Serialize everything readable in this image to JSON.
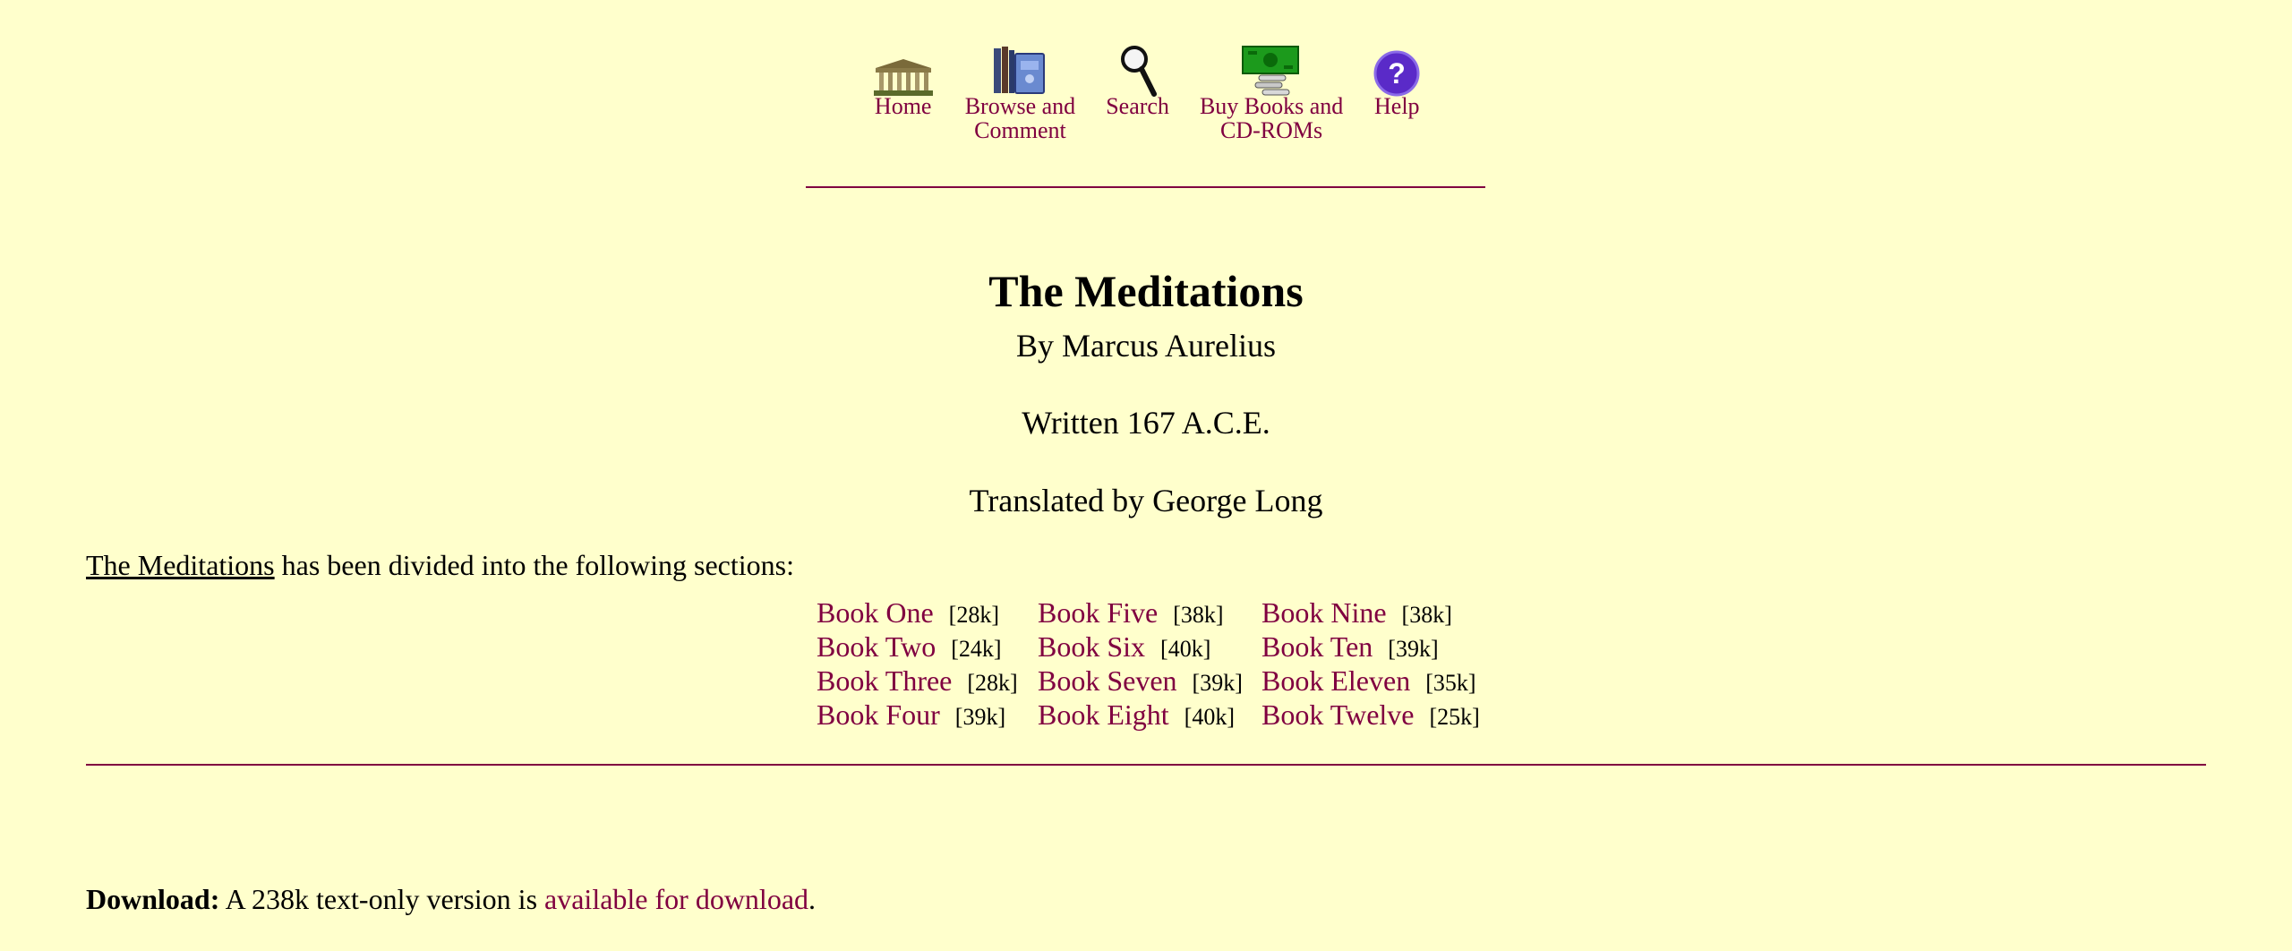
{
  "nav": [
    {
      "icon": "home-temple-icon",
      "label_lines": [
        "Home"
      ]
    },
    {
      "icon": "browse-books-icon",
      "label_lines": [
        "Browse and",
        "Comment"
      ]
    },
    {
      "icon": "search-magnifier-icon",
      "label_lines": [
        "Search"
      ]
    },
    {
      "icon": "buy-books-money-icon",
      "label_lines": [
        "Buy Books and",
        "CD-ROMs"
      ]
    },
    {
      "icon": "help-question-icon",
      "label_lines": [
        "Help"
      ]
    }
  ],
  "page": {
    "title": "The Meditations",
    "author": "By Marcus Aurelius",
    "written": "Written 167 A.C.E.",
    "translator": "Translated by George Long",
    "intro_title": "The Meditations",
    "intro_rest": " has been divided into the following sections:"
  },
  "books": [
    {
      "label": "Book One",
      "size": "[28k]"
    },
    {
      "label": "Book Five",
      "size": "[38k]"
    },
    {
      "label": "Book Nine",
      "size": "[38k]"
    },
    {
      "label": "Book Two",
      "size": "[24k]"
    },
    {
      "label": "Book Six",
      "size": "[40k]"
    },
    {
      "label": "Book Ten",
      "size": "[39k]"
    },
    {
      "label": "Book Three",
      "size": "[28k]"
    },
    {
      "label": "Book Seven",
      "size": "[39k]"
    },
    {
      "label": "Book Eleven",
      "size": "[35k]"
    },
    {
      "label": "Book Four",
      "size": "[39k]"
    },
    {
      "label": "Book Eight",
      "size": "[40k]"
    },
    {
      "label": "Book Twelve",
      "size": "[25k]"
    }
  ],
  "download": {
    "label": "Download:",
    "text": " A 238k text-only version is ",
    "link": "available for download",
    "end": "."
  },
  "colors": {
    "background": "#ffffcc",
    "link": "#800040",
    "rule": "#800040"
  }
}
